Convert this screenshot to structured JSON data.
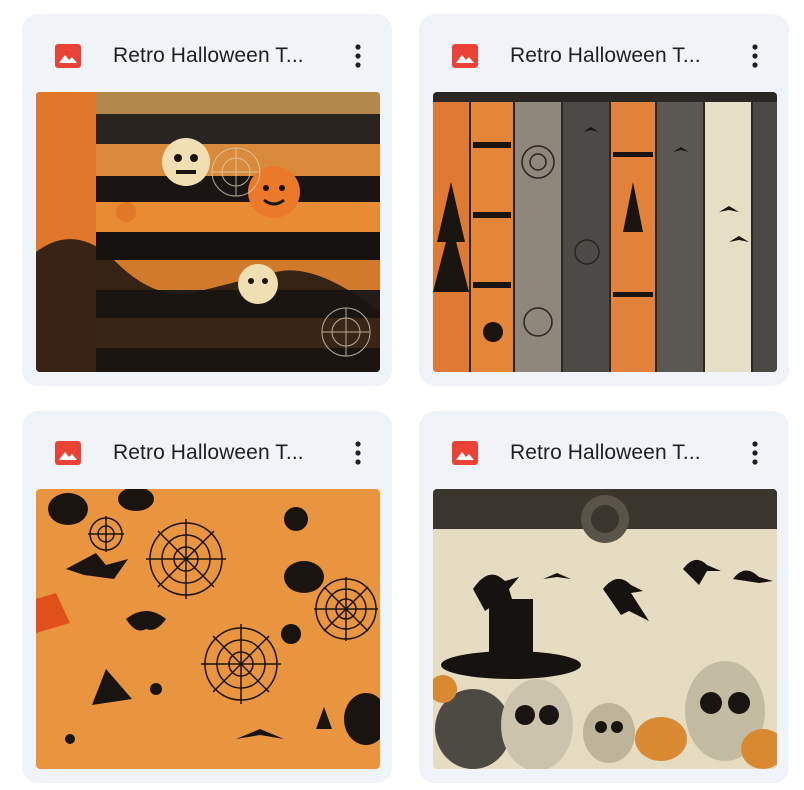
{
  "files": [
    {
      "title": "Retro Halloween T...",
      "type_icon": "image-icon",
      "menu_icon": "more-vert-icon"
    },
    {
      "title": "Retro Halloween T...",
      "type_icon": "image-icon",
      "menu_icon": "more-vert-icon"
    },
    {
      "title": "Retro Halloween T...",
      "type_icon": "image-icon",
      "menu_icon": "more-vert-icon"
    },
    {
      "title": "Retro Halloween T...",
      "type_icon": "image-icon",
      "menu_icon": "more-vert-icon"
    }
  ],
  "colors": {
    "card_bg": "#f0f4f9",
    "image_icon_red": "#ea4335",
    "title_text": "#1f1f1f",
    "orange": "#e88533",
    "black": "#1a1410",
    "cream": "#e8dfc4"
  }
}
